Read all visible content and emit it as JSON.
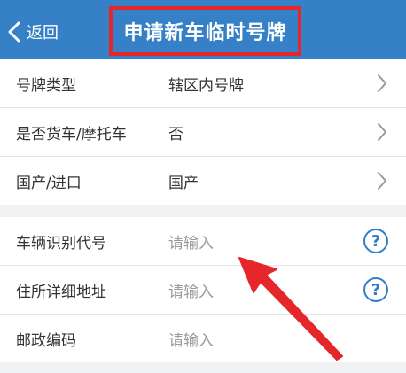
{
  "header": {
    "back_label": "返回",
    "title": "申请新车临时号牌"
  },
  "form_group_1": [
    {
      "label": "号牌类型",
      "value": "辖区内号牌"
    },
    {
      "label": "是否货车/摩托车",
      "value": "否"
    },
    {
      "label": "国产/进口",
      "value": "国产"
    }
  ],
  "form_group_2": [
    {
      "label": "车辆识别代号",
      "placeholder": "请输入"
    },
    {
      "label": "住所详细地址",
      "placeholder": "请输入"
    },
    {
      "label": "邮政编码",
      "placeholder": "请输入"
    }
  ],
  "help_glyph": "?",
  "colors": {
    "header_bg": "#3580c6",
    "highlight_box": "#e5262a",
    "annotation_arrow": "#e5262a",
    "help_icon": "#2f7fc8"
  },
  "icons": [
    "chevron-left-icon",
    "chevron-right-icon",
    "question-mark-icon"
  ]
}
